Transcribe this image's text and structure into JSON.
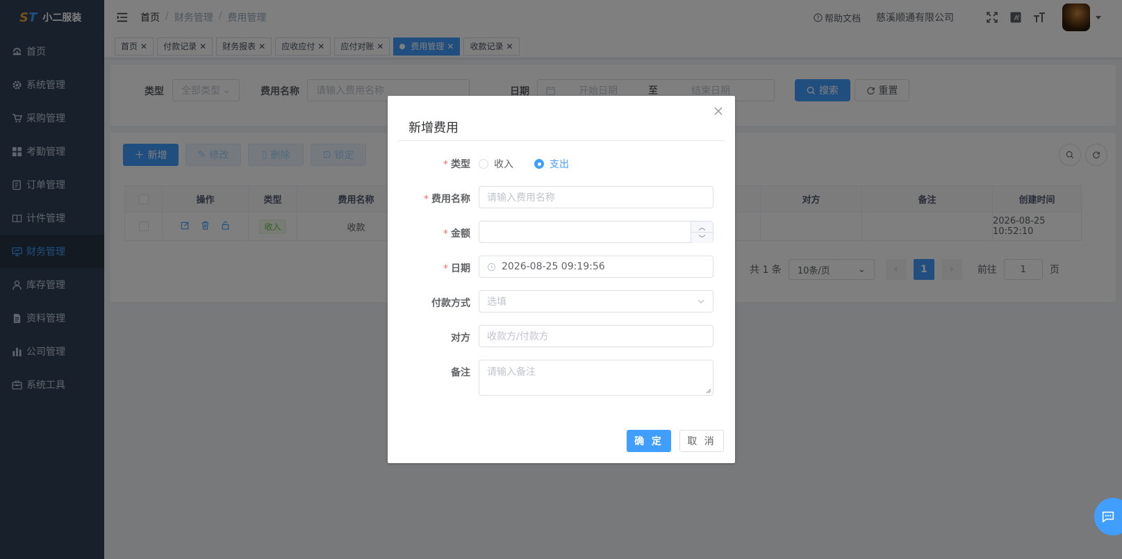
{
  "app": {
    "logo_mark": "ST",
    "name": "小二服装"
  },
  "sidebar": {
    "items": [
      {
        "label": "首页",
        "icon": "dashboard-icon"
      },
      {
        "label": "系统管理",
        "icon": "gear-icon"
      },
      {
        "label": "采购管理",
        "icon": "cart-icon"
      },
      {
        "label": "考勤管理",
        "icon": "grid-icon"
      },
      {
        "label": "订单管理",
        "icon": "order-icon"
      },
      {
        "label": "计件管理",
        "icon": "book-icon"
      },
      {
        "label": "财务管理",
        "icon": "monitor-icon",
        "active": true
      },
      {
        "label": "库存管理",
        "icon": "user-icon"
      },
      {
        "label": "资料管理",
        "icon": "document-icon"
      },
      {
        "label": "公司管理",
        "icon": "bar-chart-icon"
      },
      {
        "label": "系统工具",
        "icon": "toolbox-icon"
      }
    ]
  },
  "header": {
    "breadcrumb": [
      "首页",
      "财务管理",
      "费用管理"
    ],
    "help": "帮助文档",
    "company": "慈溪顺通有限公司"
  },
  "tags": [
    "首页",
    "付款记录",
    "财务报表",
    "应收应付",
    "应付对账",
    "费用管理",
    "收款记录"
  ],
  "active_tag": "费用管理",
  "search": {
    "type_label": "类型",
    "type_value": "全部类型",
    "name_label": "费用名称",
    "name_placeholder": "请输入费用名称",
    "date_label": "日期",
    "start_placeholder": "开始日期",
    "range_sep": "至",
    "end_placeholder": "结束日期",
    "search_btn": "搜索",
    "reset_btn": "重置"
  },
  "toolbar": {
    "add": "新增",
    "edit": "修改",
    "delete": "删除",
    "lock": "锁定"
  },
  "table": {
    "columns": [
      "操作",
      "类型",
      "费用名称",
      "对方",
      "备注",
      "创建时间"
    ],
    "rows": [
      {
        "type": "收入",
        "name": "收款",
        "party": "",
        "note": "",
        "created": "2026-08-25 10:52:10"
      }
    ]
  },
  "pagination": {
    "total": "共 1 条",
    "page_size": "10条/页",
    "current": "1",
    "goto_label": "前往",
    "goto_value": "1",
    "page_suffix": "页"
  },
  "dialog": {
    "title": "新增费用",
    "type_label": "类型",
    "type_options": [
      "收入",
      "支出"
    ],
    "type_selected": "支出",
    "name_label": "费用名称",
    "name_placeholder": "请输入费用名称",
    "amount_label": "金额",
    "amount_value": "",
    "date_label": "日期",
    "date_value": "2026-08-25 09:19:56",
    "payment_label": "付款方式",
    "payment_placeholder": "选填",
    "party_label": "对方",
    "party_placeholder": "收款方/付款方",
    "note_label": "备注",
    "note_placeholder": "请输入备注",
    "confirm": "确 定",
    "cancel": "取 消"
  },
  "colors": {
    "primary": "#409eff",
    "sidebar": "#304156",
    "danger": "#f56c6c"
  }
}
